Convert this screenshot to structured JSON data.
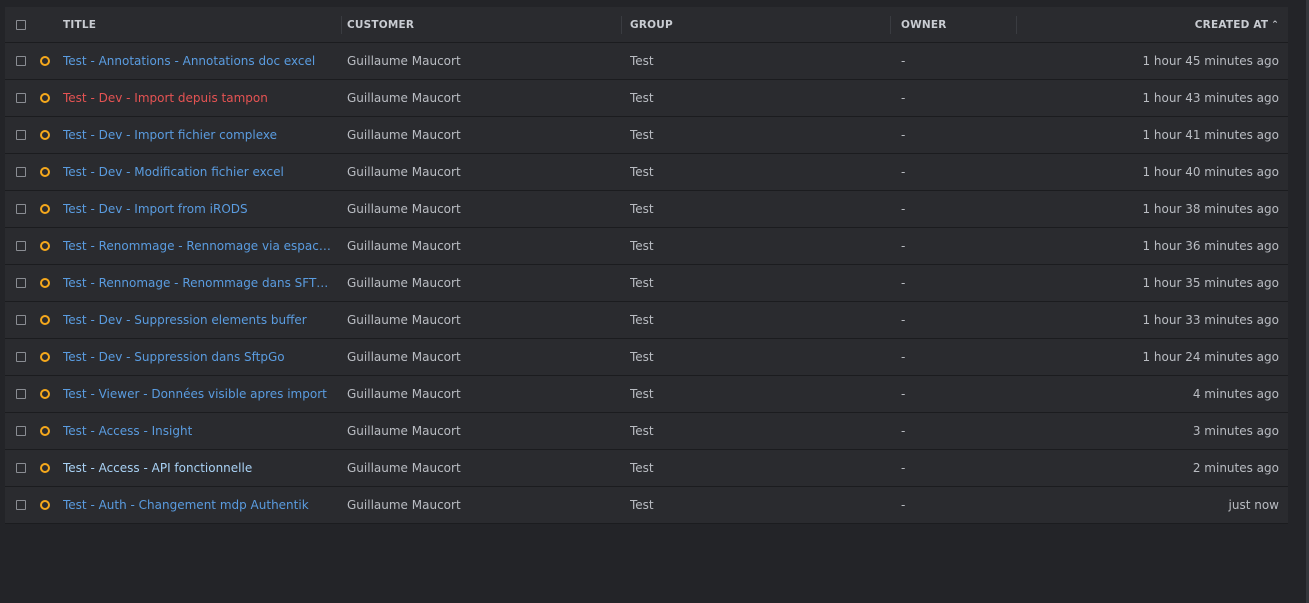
{
  "header": {
    "title": "TITLE",
    "customer": "CUSTOMER",
    "group": "GROUP",
    "owner": "OWNER",
    "created_at": "CREATED AT",
    "sort_icon": "chevron-up-icon"
  },
  "colors": {
    "default_title": "#5a9ce0",
    "error_title": "#e55353",
    "active_title": "#a9d2f5",
    "status_ring": "#f5a81c"
  },
  "rows": [
    {
      "title": "Test - Annotations - Annotations doc excel",
      "customer": "Guillaume Maucort",
      "group": "Test",
      "owner": "-",
      "created_at": "1 hour 45 minutes ago",
      "title_color": "#5a9ce0"
    },
    {
      "title": "Test - Dev - Import depuis tampon",
      "customer": "Guillaume Maucort",
      "group": "Test",
      "owner": "-",
      "created_at": "1 hour 43 minutes ago",
      "title_color": "#e55353"
    },
    {
      "title": "Test - Dev - Import fichier complexe",
      "customer": "Guillaume Maucort",
      "group": "Test",
      "owner": "-",
      "created_at": "1 hour 41 minutes ago",
      "title_color": "#5a9ce0"
    },
    {
      "title": "Test - Dev - Modification fichier excel",
      "customer": "Guillaume Maucort",
      "group": "Test",
      "owner": "-",
      "created_at": "1 hour 40 minutes ago",
      "title_color": "#5a9ce0"
    },
    {
      "title": "Test - Dev - Import from iRODS",
      "customer": "Guillaume Maucort",
      "group": "Test",
      "owner": "-",
      "created_at": "1 hour 38 minutes ago",
      "title_color": "#5a9ce0"
    },
    {
      "title": "Test - Renommage - Rennomage via espace t…",
      "customer": "Guillaume Maucort",
      "group": "Test",
      "owner": "-",
      "created_at": "1 hour 36 minutes ago",
      "title_color": "#5a9ce0"
    },
    {
      "title": "Test - Rennomage - Renommage dans SFTPGo",
      "customer": "Guillaume Maucort",
      "group": "Test",
      "owner": "-",
      "created_at": "1 hour 35 minutes ago",
      "title_color": "#5a9ce0"
    },
    {
      "title": "Test - Dev - Suppression elements buffer",
      "customer": "Guillaume Maucort",
      "group": "Test",
      "owner": "-",
      "created_at": "1 hour 33 minutes ago",
      "title_color": "#5a9ce0"
    },
    {
      "title": "Test - Dev - Suppression dans SftpGo",
      "customer": "Guillaume Maucort",
      "group": "Test",
      "owner": "-",
      "created_at": "1 hour 24 minutes ago",
      "title_color": "#5a9ce0"
    },
    {
      "title": "Test - Viewer - Données visible apres import",
      "customer": "Guillaume Maucort",
      "group": "Test",
      "owner": "-",
      "created_at": "4 minutes ago",
      "title_color": "#5a9ce0"
    },
    {
      "title": "Test - Access - Insight",
      "customer": "Guillaume Maucort",
      "group": "Test",
      "owner": "-",
      "created_at": "3 minutes ago",
      "title_color": "#5a9ce0"
    },
    {
      "title": "Test - Access - API fonctionnelle",
      "customer": "Guillaume Maucort",
      "group": "Test",
      "owner": "-",
      "created_at": "2 minutes ago",
      "title_color": "#a9d2f5"
    },
    {
      "title": "Test - Auth - Changement mdp Authentik",
      "customer": "Guillaume Maucort",
      "group": "Test",
      "owner": "-",
      "created_at": "just now",
      "title_color": "#5a9ce0"
    }
  ]
}
